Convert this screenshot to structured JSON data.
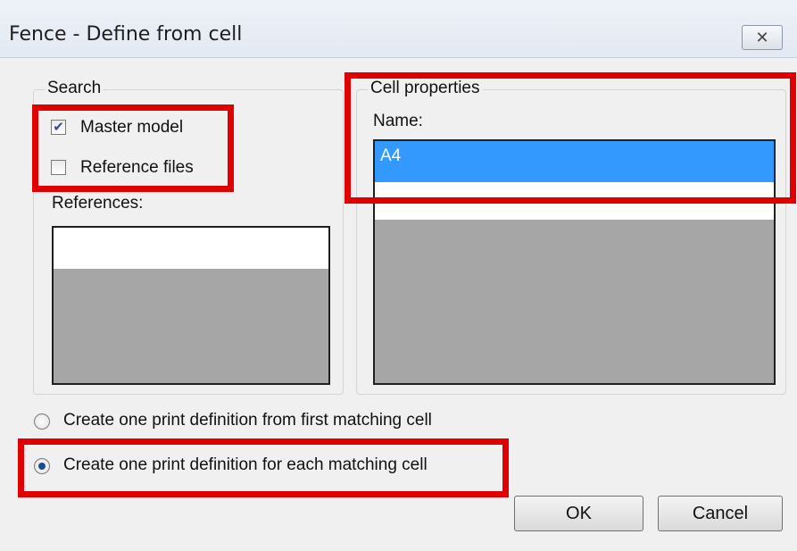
{
  "window": {
    "title": "Fence - Define from cell",
    "close_icon": "close-icon"
  },
  "search": {
    "legend": "Search",
    "master_model": {
      "label": "Master model",
      "checked": true
    },
    "reference_files": {
      "label": "Reference files",
      "checked": false
    },
    "references_label": "References:"
  },
  "cell_properties": {
    "legend": "Cell properties",
    "name_label": "Name:",
    "items": [
      "A4"
    ],
    "selected": "A4"
  },
  "options": {
    "first_matching": {
      "label": "Create one print definition from first matching cell",
      "selected": false
    },
    "each_matching": {
      "label": "Create one print definition for each matching cell",
      "selected": true
    }
  },
  "buttons": {
    "ok": "OK",
    "cancel": "Cancel"
  },
  "colors": {
    "highlight": "#e00000",
    "selection": "#3399ff"
  }
}
